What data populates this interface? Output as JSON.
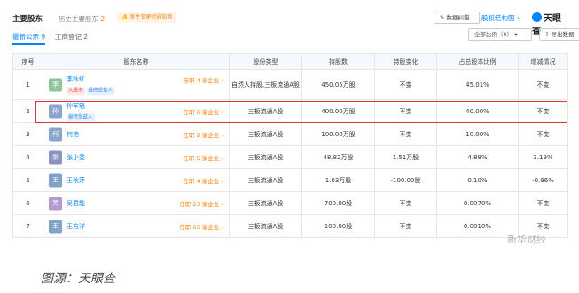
{
  "header": {
    "title": "主要股东",
    "history_label": "历史主要股东",
    "history_count": "2",
    "notice": "发生变更时通知我",
    "report_button": "数据纠错",
    "structure_link": "股权结构图",
    "brand": "天眼查"
  },
  "tabs": [
    {
      "label": "最新公示 9",
      "active": true
    },
    {
      "label": "工商登记 2",
      "active": false
    }
  ],
  "toolbar": {
    "filter": "全部比例（9）",
    "export": "导出数据"
  },
  "table": {
    "columns": [
      "序号",
      "股东名称",
      "股份类型",
      "持股数",
      "持股变化",
      "占总股本比例",
      "增减情况"
    ],
    "rows": [
      {
        "index": "1",
        "avatar": "李",
        "avatar_color": "#8fc49a",
        "name": "李秋红",
        "office": "任职 4 家企业",
        "tags": [
          {
            "text": "大股东",
            "style": "red"
          },
          {
            "text": "最终受益人",
            "style": "blue"
          }
        ],
        "share_type": "自然人持股,三板流通A股",
        "shares": "450.05万股",
        "change": "不变",
        "ratio": "45.01%",
        "trend": "不变"
      },
      {
        "index": "2",
        "avatar": "孙",
        "avatar_color": "#8aa5c9",
        "name": "孙军魁",
        "office": "任职 6 家企业",
        "tags": [
          {
            "text": "最终受益人",
            "style": "blue"
          }
        ],
        "share_type": "三板流通A股",
        "shares": "400.00万股",
        "change": "不变",
        "ratio": "40.00%",
        "trend": "不变"
      },
      {
        "index": "3",
        "avatar": "何",
        "avatar_color": "#8aa5c9",
        "name": "何艳",
        "office": "任职 2 家企业",
        "tags": [],
        "share_type": "三板流通A股",
        "shares": "100.00万股",
        "change": "不变",
        "ratio": "10.00%",
        "trend": "不变"
      },
      {
        "index": "4",
        "avatar": "张",
        "avatar_color": "#8a93c4",
        "name": "张小委",
        "office": "任职 5 家企业",
        "tags": [],
        "share_type": "三板流通A股",
        "shares": "48.82万股",
        "change": "1.51万股",
        "ratio": "4.88%",
        "trend": "3.19%"
      },
      {
        "index": "5",
        "avatar": "王",
        "avatar_color": "#7fa2c8",
        "name": "王秋萍",
        "office": "任职 4 家企业",
        "tags": [],
        "share_type": "三板流通A股",
        "shares": "1.03万股",
        "change": "-100.00股",
        "ratio": "0.10%",
        "trend": "-0.96%"
      },
      {
        "index": "6",
        "avatar": "吴",
        "avatar_color": "#b59ad0",
        "name": "吴君能",
        "office": "任职 23 家企业",
        "tags": [],
        "share_type": "三板流通A股",
        "shares": "700.00股",
        "change": "不变",
        "ratio": "0.0070%",
        "trend": "不变"
      },
      {
        "index": "7",
        "avatar": "王",
        "avatar_color": "#7fa2c8",
        "name": "王方洋",
        "office": "任职 65 家企业",
        "tags": [],
        "share_type": "三板流通A股",
        "shares": "100.00股",
        "change": "不变",
        "ratio": "0.0010%",
        "trend": "不变"
      }
    ]
  },
  "caption": "图源：天眼查",
  "watermark": "新华财经",
  "colors": {
    "accent": "#0084ff",
    "highlight": "#e23434",
    "office": "#ff7d00"
  }
}
